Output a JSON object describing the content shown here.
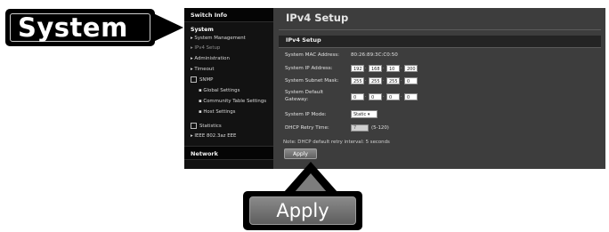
{
  "callouts": {
    "system": "System",
    "apply": "Apply"
  },
  "sidebar": {
    "switch_info": "Switch Info",
    "system": "System",
    "items": {
      "system_management": "System Management",
      "ipv4_setup": "IPv4 Setup",
      "administration": "Administration",
      "timeout": "Timeout",
      "snmp": "SNMP",
      "global_settings": "Global Settings",
      "community_table_settings": "Community Table Settings",
      "host_settings": "Host Settings",
      "statistics": "Statistics",
      "ieee": "IEEE 802.3az EEE"
    },
    "network": "Network"
  },
  "main": {
    "page_title": "IPv4 Setup",
    "section_title": "IPv4 Setup",
    "labels": {
      "mac": "System MAC Address:",
      "ip": "System IP Address:",
      "subnet": "System Subnet Mask:",
      "gateway_1": "System Default",
      "gateway_2": "Gateway:",
      "mode": "System IP Mode:",
      "dhcp_retry": "DHCP Retry Time:"
    },
    "mac_value": "80:26:89:3C:C0:50",
    "ip": [
      "192",
      "168",
      "10",
      "200"
    ],
    "subnet": [
      "255",
      "255",
      "255",
      "0"
    ],
    "gateway": [
      "0",
      "0",
      "0",
      "0"
    ],
    "ip_mode": "Static",
    "dhcp_retry_value": "7",
    "dhcp_range": "(5-120)",
    "note": "Note: DHCP default retry interval: 5 seconds",
    "apply_label": "Apply"
  }
}
